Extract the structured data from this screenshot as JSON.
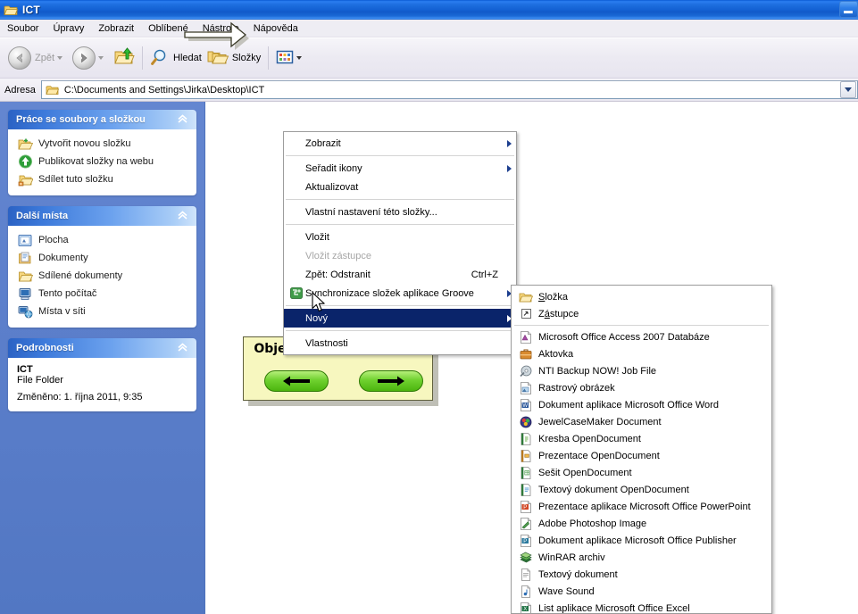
{
  "window": {
    "title": "ICT",
    "title_icon": "folder-icon",
    "minimize_label": "_"
  },
  "menubar": {
    "items": [
      {
        "label": "Soubor"
      },
      {
        "label": "Úpravy"
      },
      {
        "label": "Zobrazit"
      },
      {
        "label": "Oblíbené"
      },
      {
        "label": "Nástroje"
      },
      {
        "label": "Nápověda"
      }
    ]
  },
  "toolbar": {
    "back_label": "Zpět",
    "forward_label": "",
    "search_label": "Hledat",
    "folders_label": "Složky",
    "views_label": ""
  },
  "address": {
    "label": "Adresa",
    "value": "C:\\Documents and Settings\\Jirka\\Desktop\\ICT"
  },
  "sidebar": {
    "panels": [
      {
        "title": "Práce se soubory a složkou",
        "items": [
          {
            "label": "Vytvořit novou složku",
            "icon": "new-folder-icon"
          },
          {
            "label": "Publikovat složky na webu",
            "icon": "publish-web-icon"
          },
          {
            "label": "Sdílet tuto složku",
            "icon": "share-folder-icon"
          }
        ]
      },
      {
        "title": "Další místa",
        "items": [
          {
            "label": "Plocha",
            "icon": "desktop-icon"
          },
          {
            "label": "Dokumenty",
            "icon": "documents-icon"
          },
          {
            "label": "Sdílené dokumenty",
            "icon": "shared-documents-icon"
          },
          {
            "label": "Tento počítač",
            "icon": "my-computer-icon"
          },
          {
            "label": "Místa v síti",
            "icon": "network-places-icon"
          }
        ]
      }
    ],
    "details": {
      "title": "Podrobnosti",
      "name": "ICT",
      "type": "File Folder",
      "modified": "Změněno: 1. října 2011, 9:35"
    }
  },
  "context_menu": {
    "items": [
      {
        "label": "Zobrazit",
        "submenu": true,
        "sep_after": true
      },
      {
        "label": "Seřadit ikony",
        "submenu": true
      },
      {
        "label": "Aktualizovat",
        "sep_after": true
      },
      {
        "label": "Vlastní nastavení této složky...",
        "sep_after": true
      },
      {
        "label": "Vložit"
      },
      {
        "label": "Vložit zástupce",
        "disabled": true
      },
      {
        "label": "Zpět: Odstranit",
        "accel": "Ctrl+Z"
      },
      {
        "label": "Synchronizace složek aplikace Groove",
        "icon": "groove-icon",
        "submenu": true,
        "sep_after": true
      },
      {
        "label": "Nový",
        "submenu": true,
        "selected": true,
        "sep_after": true
      },
      {
        "label": "Vlastnosti"
      }
    ]
  },
  "submenu": {
    "items": [
      {
        "label": "Složka",
        "icon": "folder-icon",
        "accel_index": 0
      },
      {
        "label": "Zástupce",
        "icon": "shortcut-icon",
        "accel_index": 1,
        "sep_after": true
      },
      {
        "label": "Microsoft Office Access 2007 Databáze",
        "icon": "access-icon"
      },
      {
        "label": "Aktovka",
        "icon": "briefcase-icon"
      },
      {
        "label": "NTI Backup NOW! Job File",
        "icon": "nti-backup-icon"
      },
      {
        "label": "Rastrový obrázek",
        "icon": "bitmap-icon"
      },
      {
        "label": "Dokument aplikace Microsoft Office Word",
        "icon": "word-icon"
      },
      {
        "label": "JewelCaseMaker Document",
        "icon": "jewelcase-icon"
      },
      {
        "label": "Kresba OpenDocument",
        "icon": "odg-icon"
      },
      {
        "label": "Prezentace OpenDocument",
        "icon": "odp-icon"
      },
      {
        "label": "Sešit OpenDocument",
        "icon": "ods-icon"
      },
      {
        "label": "Textový dokument OpenDocument",
        "icon": "odt-icon"
      },
      {
        "label": "Prezentace aplikace Microsoft Office PowerPoint",
        "icon": "powerpoint-icon"
      },
      {
        "label": "Adobe Photoshop Image",
        "icon": "photoshop-icon"
      },
      {
        "label": "Dokument aplikace Microsoft Office Publisher",
        "icon": "publisher-icon"
      },
      {
        "label": "WinRAR archiv",
        "icon": "winrar-icon"
      },
      {
        "label": "Textový dokument",
        "icon": "textfile-icon"
      },
      {
        "label": "Wave Sound",
        "icon": "wave-icon"
      },
      {
        "label": "List aplikace Microsoft Office Excel",
        "icon": "excel-icon"
      }
    ]
  },
  "callout": {
    "text": "Objeví se další nabídka.",
    "prev_label": "←",
    "next_label": "→"
  },
  "colors": {
    "titlebar_blue": "#1462d4",
    "sidebar_blue": "#5a7fc8",
    "panel_header_blue": "#3c79da",
    "selection_blue": "#0a246a",
    "callout_yellow": "#f7f7bf",
    "pill_green": "#4cb50f"
  }
}
